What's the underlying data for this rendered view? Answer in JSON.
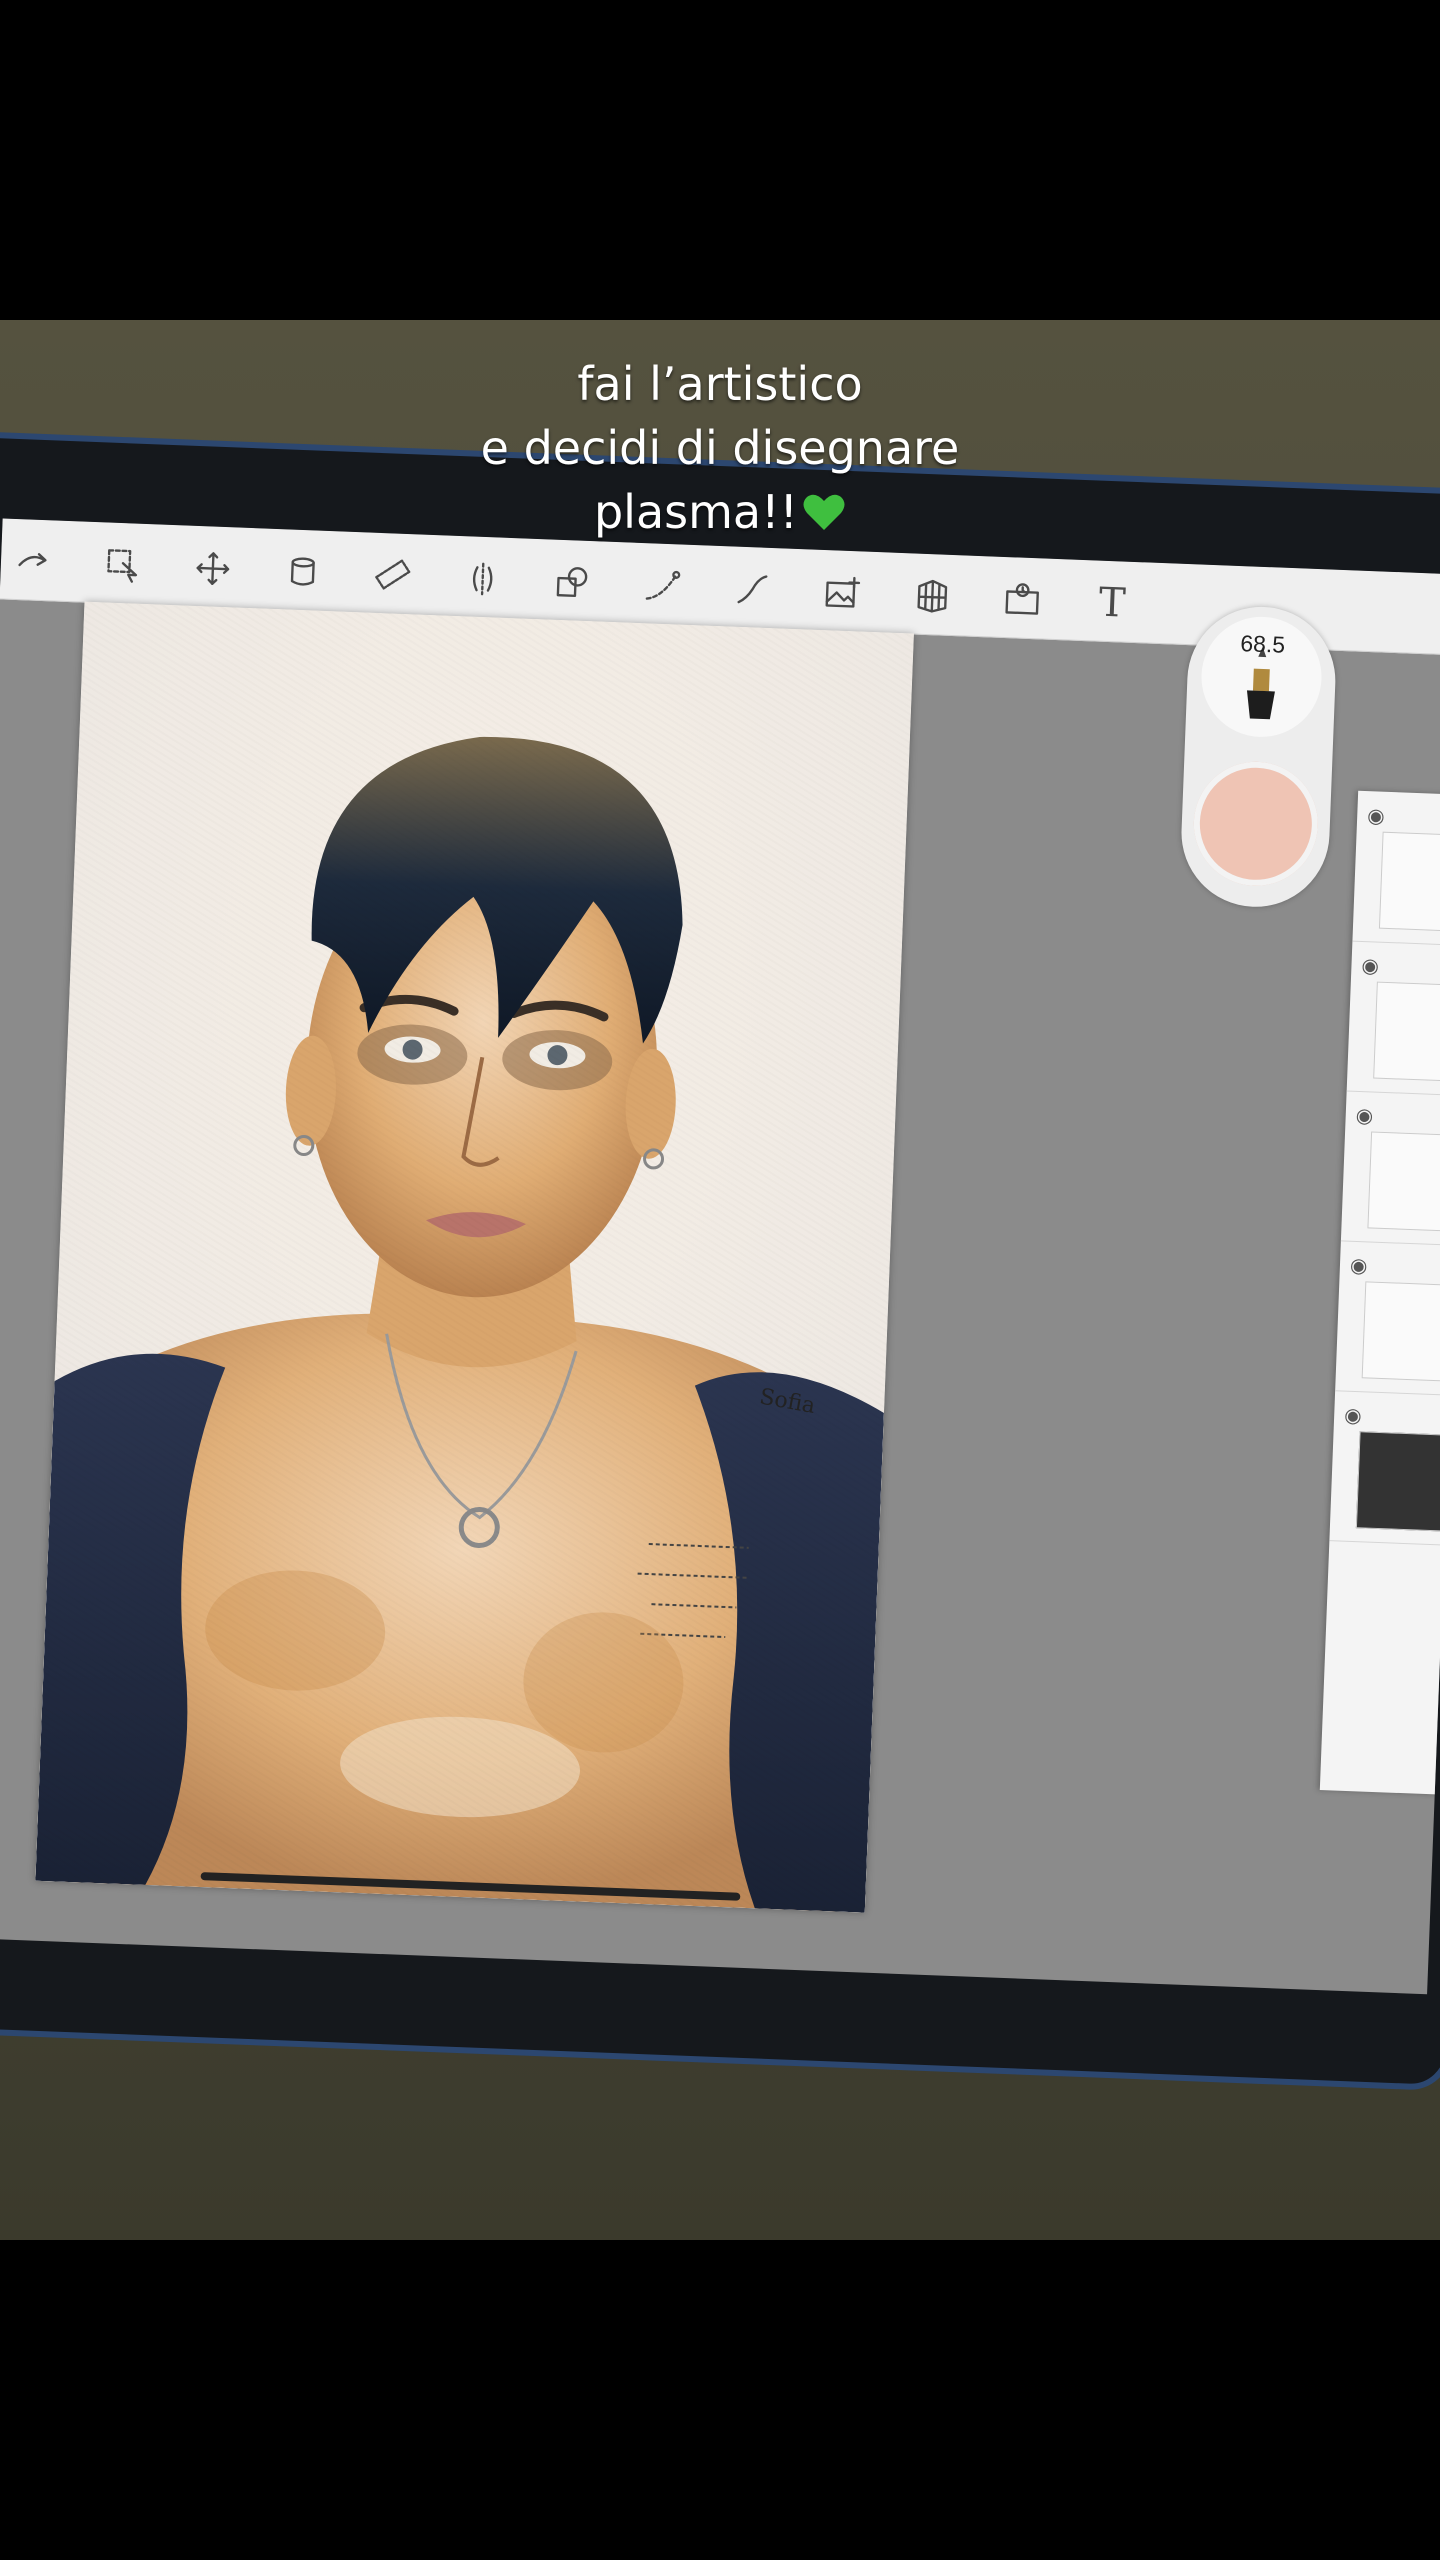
{
  "caption": {
    "line1": "fai l’artistico",
    "line2": "e decidi di disegnare",
    "line3": "plasma!!"
  },
  "toolbar": {
    "grabber": "•••",
    "tools": [
      "undo-icon",
      "redo-icon",
      "selection-icon",
      "transform-icon",
      "fill-icon",
      "ruler-icon",
      "symmetry-icon",
      "shapes-icon",
      "curve-icon",
      "stroke-icon",
      "image-icon",
      "perspective-icon",
      "reference-icon",
      "text-icon"
    ],
    "text_tool_label": "T"
  },
  "brush": {
    "size": "68.5",
    "color": "#efc4b4"
  },
  "artwork": {
    "signature": "Sofia"
  },
  "colors": {
    "heart": "#3fbf3f",
    "tablet_frame": "#2c4770"
  }
}
